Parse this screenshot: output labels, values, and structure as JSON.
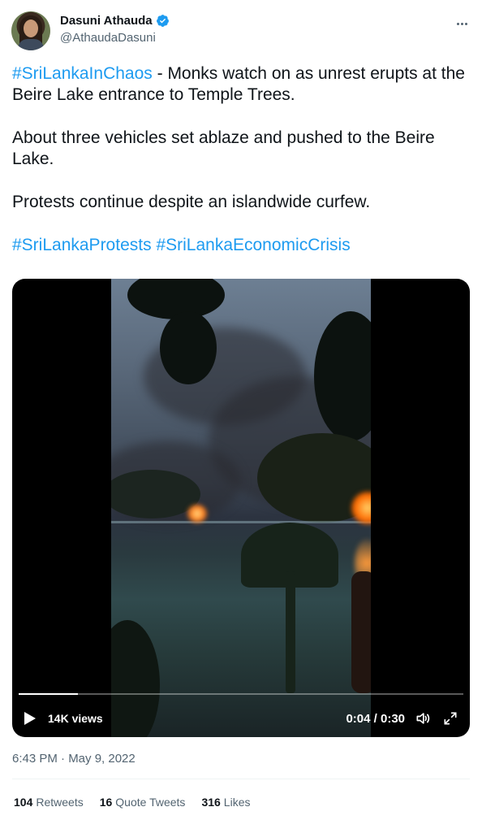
{
  "author": {
    "display_name": "Dasuni Athauda",
    "handle": "@AthaudaDasuni",
    "verified": true
  },
  "tweet": {
    "hashtag_1": "#SriLankaInChaos",
    "line_1_rest": " - Monks watch on as unrest erupts at the Beire Lake entrance to Temple Trees.",
    "paragraph_2": "About three vehicles set ablaze and pushed to the Beire Lake.",
    "paragraph_3": "Protests continue despite an islandwide curfew.",
    "hashtag_2": "#SriLankaProtests",
    "hashtag_3": "#SriLankaEconomicCrisis"
  },
  "video": {
    "views": "14K views",
    "time": "0:04 / 0:30",
    "progress": 0.133
  },
  "timestamp": "6:43 PM · May 9, 2022",
  "stats": {
    "retweets_count": "104",
    "retweets_label": "Retweets",
    "quotes_count": "16",
    "quotes_label": "Quote Tweets",
    "likes_count": "316",
    "likes_label": "Likes"
  },
  "colors": {
    "link": "#1d9bf0",
    "text": "#0f1419",
    "secondary": "#536471",
    "verified_badge": "#1d9bf0"
  }
}
